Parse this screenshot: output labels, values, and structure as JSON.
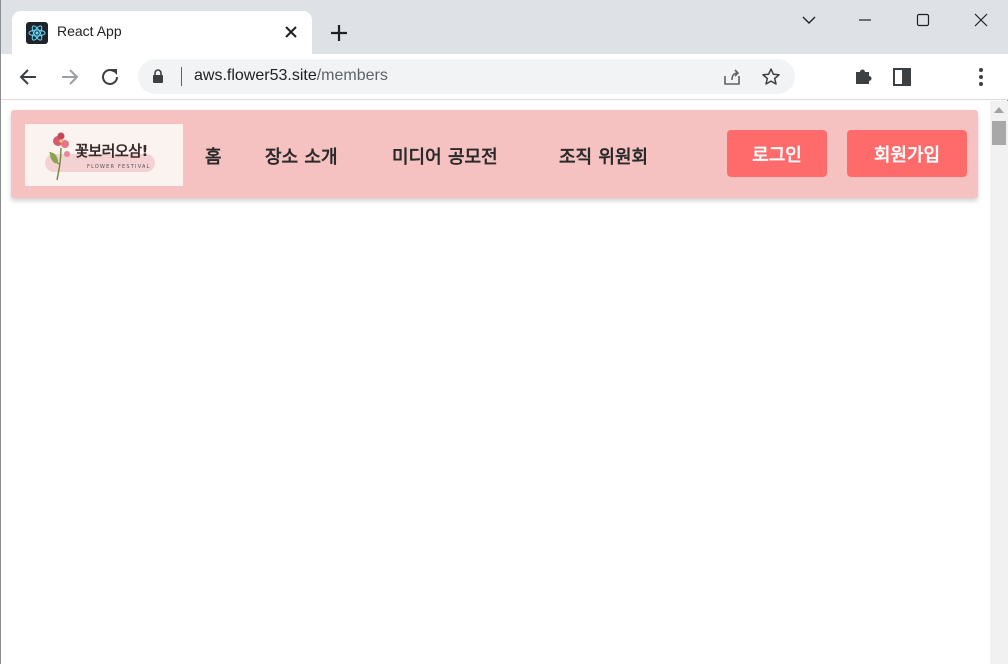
{
  "browser": {
    "tab_title": "React App",
    "url_host": "aws.flower53.site",
    "url_path": "/members"
  },
  "site": {
    "logo": {
      "title": "꽃보러오삼!",
      "subtitle": "FLOWER FESTIVAL"
    },
    "nav": [
      {
        "label": "홈"
      },
      {
        "label": "장소 소개"
      },
      {
        "label": "미디어 공모전"
      },
      {
        "label": "조직 위원회"
      }
    ],
    "login_label": "로그인",
    "signup_label": "회원가입",
    "colors": {
      "header_bg": "#f5c1c1",
      "button_bg": "#ff6b6b"
    }
  }
}
